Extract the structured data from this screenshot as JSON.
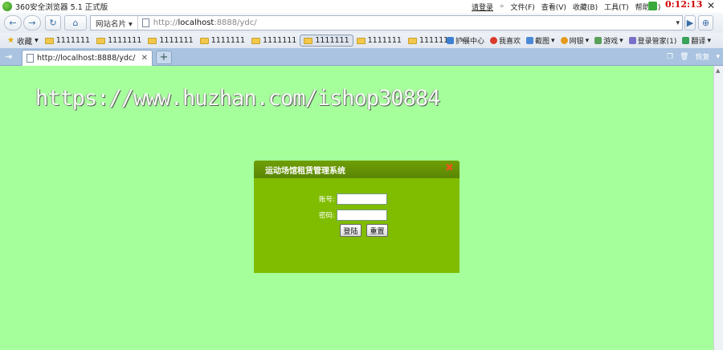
{
  "window": {
    "title": "360安全浏览器 5.1 正式版",
    "login_link": "请登录",
    "more": "»",
    "menus": [
      "文件(F)",
      "查看(V)",
      "收藏(B)",
      "工具(T)",
      "帮助(H)"
    ],
    "clock": "0:12:13",
    "close_glyph": "✕"
  },
  "nav": {
    "back": "←",
    "forward": "→",
    "refresh": "↻",
    "home": "⌂",
    "sites_label": "网站名片 ▾",
    "url_prefix": "http://",
    "url_host": "localhost",
    "url_rest": ":8888/ydc/",
    "go": "▶",
    "shield": "⊕",
    "dropdown": "▾"
  },
  "bookmarks": {
    "favorites_label": "收藏",
    "items": [
      "1111111",
      "1111111",
      "1111111",
      "1111111",
      "1111111",
      "1111111",
      "1111111",
      "1111111"
    ],
    "active_index": 5,
    "overflow": "»",
    "tools": [
      "扩展中心",
      "我喜欢",
      "截图",
      "网银",
      "游戏",
      "登录管家(1)",
      "翻译"
    ]
  },
  "tabs": {
    "items": [
      {
        "title": "http://localhost:8888/ydc/",
        "close": "✕"
      }
    ],
    "new_tab": "+",
    "sidebar": "⇥",
    "restore_label": "恢复"
  },
  "page": {
    "watermark": "https://www.huzhan.com/ishop30884",
    "background": "#a5ff9b",
    "dialog": {
      "title": "运动场馆租赁管理系统",
      "close": "✖",
      "account_label": "账号:",
      "account_value": "",
      "password_label": "密码:",
      "password_value": "",
      "login_button": "登陆",
      "reset_button": "重置",
      "colors": {
        "header": "#5f8c04",
        "body": "#80bc00",
        "close": "#e8581c"
      }
    }
  }
}
